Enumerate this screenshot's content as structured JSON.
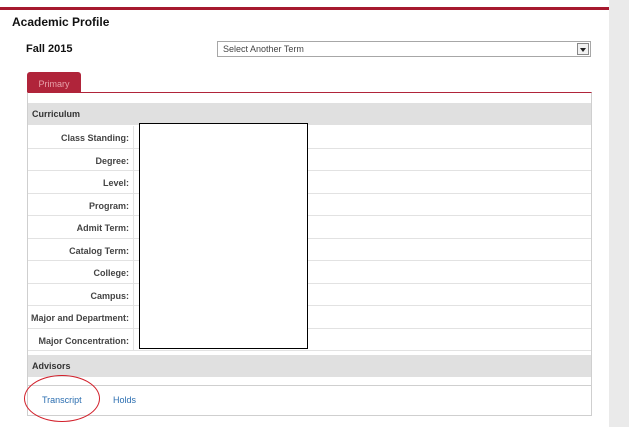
{
  "page": {
    "title": "Academic Profile",
    "term": "Fall 2015",
    "term_select": "Select Another Term"
  },
  "tabs": [
    {
      "label": "Primary",
      "active": true
    }
  ],
  "sections": {
    "curriculum": "Curriculum",
    "advisors": "Advisors"
  },
  "rows": [
    {
      "label": "Class Standing:",
      "value": ""
    },
    {
      "label": "Degree:",
      "value": ""
    },
    {
      "label": "Level:",
      "value": ""
    },
    {
      "label": "Program:",
      "value": ""
    },
    {
      "label": "Admit Term:",
      "value": ""
    },
    {
      "label": "Catalog Term:",
      "value": ""
    },
    {
      "label": "College:",
      "value": ""
    },
    {
      "label": "Campus:",
      "value": ""
    },
    {
      "label": "Major and Department:",
      "value": ""
    },
    {
      "label": "Major Concentration:",
      "value": ""
    }
  ],
  "links": {
    "transcript": "Transcript",
    "holds": "Holds"
  },
  "colors": {
    "accent": "#a6192e",
    "link": "#2a6db0",
    "annotation": "#d21f2a"
  }
}
